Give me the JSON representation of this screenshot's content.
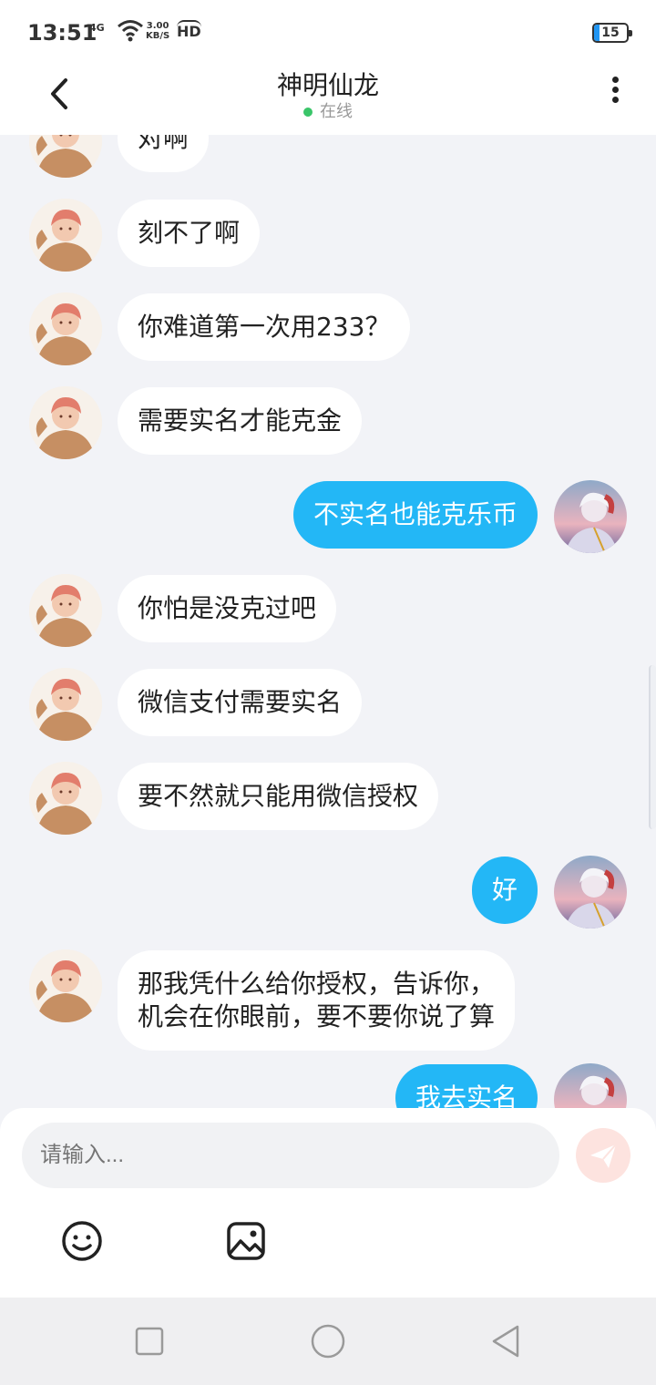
{
  "status_bar": {
    "time": "13:51",
    "network": "4G",
    "speed_value": "3.00",
    "speed_unit": "KB/S",
    "hd_label": "HD",
    "battery": "15"
  },
  "header": {
    "title": "神明仙龙",
    "status": "在线"
  },
  "messages": [
    {
      "side": "left",
      "text": "对啊",
      "avatar_icon": "orange-hair-avatar"
    },
    {
      "side": "left",
      "text": "刻不了啊",
      "avatar_icon": "orange-hair-avatar"
    },
    {
      "side": "left",
      "text": "你难道第一次用233？",
      "avatar_icon": "orange-hair-avatar"
    },
    {
      "side": "left",
      "text": "需要实名才能克金",
      "avatar_icon": "orange-hair-avatar"
    },
    {
      "side": "right",
      "text": "不实名也能克乐币",
      "avatar_icon": "white-hair-avatar"
    },
    {
      "side": "left",
      "text": "你怕是没克过吧",
      "avatar_icon": "orange-hair-avatar"
    },
    {
      "side": "left",
      "text": "微信支付需要实名",
      "avatar_icon": "orange-hair-avatar"
    },
    {
      "side": "left",
      "text": "要不然就只能用微信授权",
      "avatar_icon": "orange-hair-avatar"
    },
    {
      "side": "right",
      "text": "好",
      "avatar_icon": "white-hair-avatar"
    },
    {
      "side": "left",
      "text": "那我凭什么给你授权，告诉你，",
      "text2": "机会在你眼前，要不要你说了算",
      "avatar_icon": "orange-hair-avatar"
    },
    {
      "side": "right",
      "text": "我去实名",
      "avatar_icon": "white-hair-avatar"
    }
  ],
  "composer": {
    "placeholder": "请输入...",
    "send_icon": "paper-plane-icon",
    "emoji_icon": "smiley-icon",
    "image_icon": "image-icon"
  },
  "colors": {
    "accent": "#23b7f6",
    "online": "#3ac569",
    "send_bg": "#fde3df"
  }
}
